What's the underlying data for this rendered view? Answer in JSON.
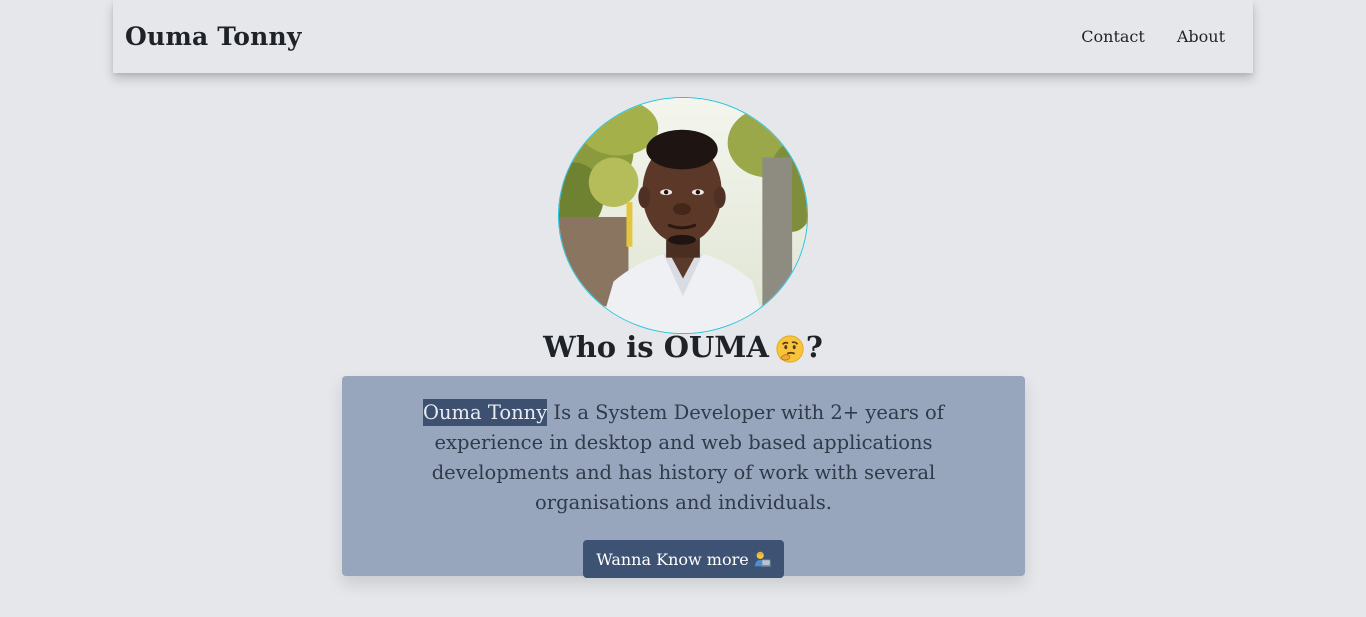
{
  "navbar": {
    "brand": "Ouma Tonny",
    "links": [
      {
        "label": "Contact"
      },
      {
        "label": "About"
      }
    ]
  },
  "hero": {
    "heading_text": "Who is OUMA",
    "heading_emoji": "thinking-face-icon",
    "heading_suffix": "?",
    "avatar_icon": "profile-photo"
  },
  "card": {
    "bio_highlight": "Ouma Tonny",
    "bio_rest": " Is a System Developer with 2+ years of experience in desktop and web based applications developments and has history of work with several organisations and individuals.",
    "button_label": "Wanna Know more",
    "button_emoji": "technologist-icon"
  },
  "colors": {
    "page_bg": "#e5e7eb",
    "card_bg": "#97a6bd",
    "button_bg": "#3e5373",
    "highlight_bg": "#3e5070",
    "avatar_border": "#22c3e0"
  }
}
